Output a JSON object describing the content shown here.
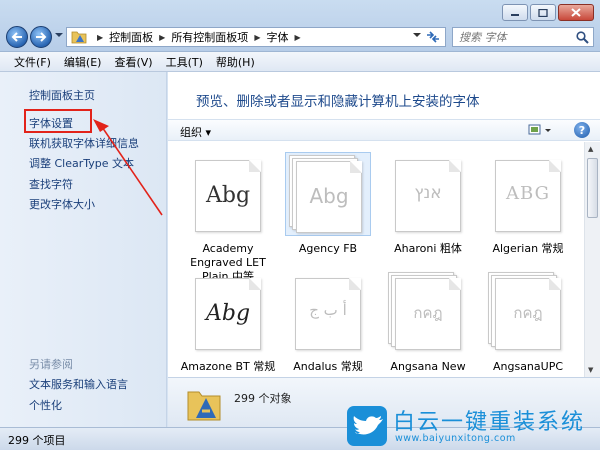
{
  "window": {
    "nav": {
      "back_label": "后退",
      "forward_label": "前进"
    },
    "breadcrumb": [
      "控制面板",
      "所有控制面板项",
      "字体"
    ],
    "search_placeholder": "搜索 字体"
  },
  "menubar": [
    "文件(F)",
    "编辑(E)",
    "查看(V)",
    "工具(T)",
    "帮助(H)"
  ],
  "sidebar": {
    "links": [
      "控制面板主页",
      "字体设置",
      "联机获取字体详细信息",
      "调整 ClearType 文本",
      "查找字符",
      "更改字体大小"
    ],
    "see_also_label": "另请参阅",
    "see_also_links": [
      "文本服务和输入语言",
      "个性化"
    ]
  },
  "main": {
    "heading": "预览、删除或者显示和隐藏计算机上安装的字体",
    "organize_label": "组织 ▾",
    "help_label": "?",
    "fonts": [
      {
        "name": "Academy Engraved LET Plain 中等",
        "sample": "Abg",
        "style": "normal",
        "selected": false
      },
      {
        "name": "Agency FB",
        "sample": "Abg",
        "style": "family",
        "selected": true
      },
      {
        "name": "Aharoni 粗体",
        "sample": "אנץ",
        "style": "hidden",
        "selected": false
      },
      {
        "name": "Algerian 常规",
        "sample": "ABG",
        "style": "hidden",
        "selected": false
      },
      {
        "name": "Amazone BT 常规",
        "sample": "Abg",
        "style": "script",
        "selected": false
      },
      {
        "name": "Andalus 常规",
        "sample": "أ ب ج",
        "style": "hidden",
        "selected": false
      },
      {
        "name": "Angsana New",
        "sample": "กคฎ",
        "style": "family",
        "selected": false
      },
      {
        "name": "AngsanaUPC",
        "sample": "กคฎ",
        "style": "family",
        "selected": false
      }
    ],
    "details_count": "299 个对象"
  },
  "statusbar": {
    "text": "299 个项目"
  },
  "watermark": {
    "title": "白云一键重装系统",
    "url": "www.baiyunxitong.com"
  },
  "colors": {
    "accent": "#1e4a8c",
    "highlight": "#e2231a",
    "watermark": "#1a8fd8"
  }
}
